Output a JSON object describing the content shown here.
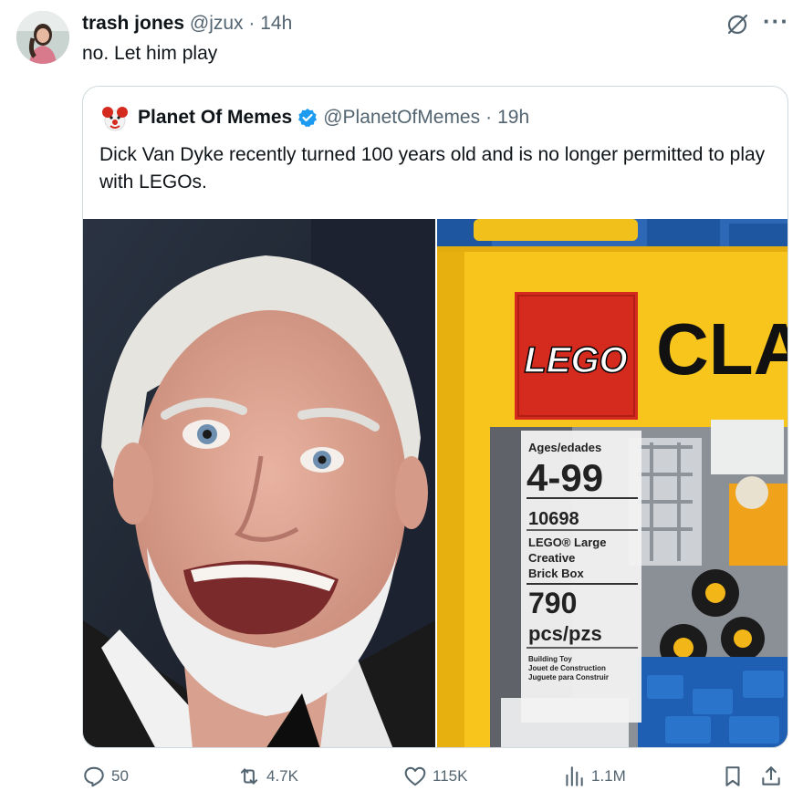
{
  "tweet": {
    "author_name": "trash jones",
    "handle": "@jzux",
    "separator": "·",
    "time": "14h",
    "text": "no. Let him play"
  },
  "quoted": {
    "author_name": "Planet Of Memes",
    "handle": "@PlanetOfMemes",
    "separator": "·",
    "time": "19h",
    "text": "Dick Van Dyke recently turned 100 years old and is no longer permitted to play with LEGOs."
  },
  "lego_box": {
    "brand": "LEGO",
    "title_fragment": "CLA",
    "ages_label": "Ages/edades",
    "ages": "4-99",
    "set_number": "10698",
    "set_name_1": "LEGO® Large",
    "set_name_2": "Creative",
    "set_name_3": "Brick Box",
    "pieces": "790",
    "pieces_label": "pcs/pzs",
    "toy_line_1": "Building Toy",
    "toy_line_2": "Jouet de Construction",
    "toy_line_3": "Juguete para Construir"
  },
  "actions": {
    "replies": "50",
    "reposts": "4.7K",
    "likes": "115K",
    "views": "1.1M"
  },
  "icons": [
    "grok-icon",
    "more-icon",
    "verified-badge-icon",
    "reply-icon",
    "repost-icon",
    "like-icon",
    "views-icon",
    "bookmark-icon",
    "share-icon"
  ],
  "colors": {
    "text": "#0f1419",
    "muted": "#536471",
    "verified": "#1d9bf0",
    "border": "#cfd9de",
    "lego_yellow": "#f7c51b",
    "lego_red": "#d52b1e"
  }
}
